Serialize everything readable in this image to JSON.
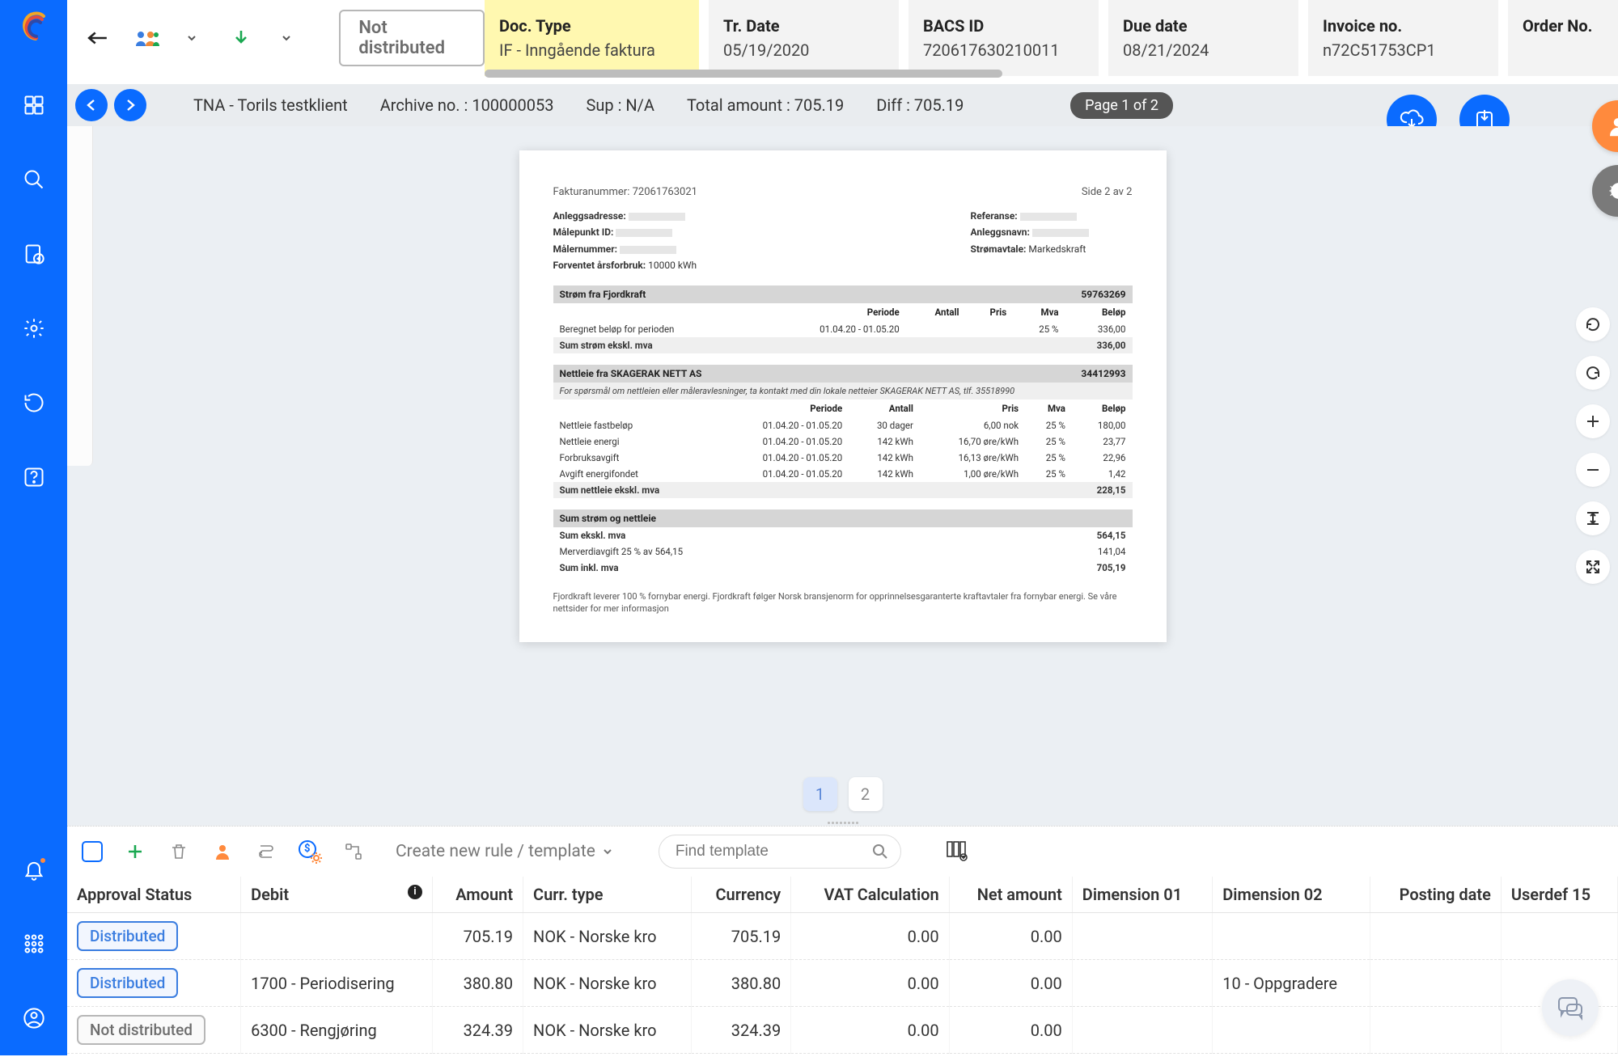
{
  "sidebar": {
    "items": [
      "dashboard",
      "search",
      "documents",
      "settings",
      "refresh",
      "help"
    ],
    "bottom": [
      "bell",
      "apps",
      "user"
    ]
  },
  "topstrip": {
    "status_chip": "Not distributed",
    "fields": [
      {
        "label": "Doc. Type",
        "value": "IF - Inngående faktura"
      },
      {
        "label": "Tr. Date",
        "value": "05/19/2020"
      },
      {
        "label": "BACS ID",
        "value": "720617630210011"
      },
      {
        "label": "Due date",
        "value": "08/21/2024"
      },
      {
        "label": "Invoice no.",
        "value": "n72C51753CP1"
      },
      {
        "label": "Order No.",
        "value": ""
      }
    ]
  },
  "metabar": {
    "client": "TNA - Torils testklient",
    "archive": "Archive no. : 100000053",
    "sup": "Sup : N/A",
    "total": "Total amount : 705.19",
    "diff": "Diff : 705.19",
    "page_pill": "Page 1 of 2"
  },
  "document": {
    "invoice_no_label": "Fakturanummer: 72061763021",
    "page_label": "Side 2 av 2",
    "meta_left": [
      {
        "k": "Anleggsadresse:",
        "v": ""
      },
      {
        "k": "Målepunkt ID:",
        "v": ""
      },
      {
        "k": "Målernummer:",
        "v": ""
      },
      {
        "k": "Forventet årsforbruk:",
        "v": "10000 kWh"
      }
    ],
    "meta_right": [
      {
        "k": "Referanse:",
        "v": ""
      },
      {
        "k": "Anleggsnavn:",
        "v": ""
      },
      {
        "k": "Strømavtale:",
        "v": "Markedskraft"
      }
    ],
    "sec1": {
      "title": "Strøm fra Fjordkraft",
      "right": "59763269",
      "headers": [
        "",
        "Periode",
        "Antall",
        "Pris",
        "Mva",
        "Beløp"
      ],
      "rows": [
        [
          "Beregnet beløp for perioden",
          "01.04.20 - 01.05.20",
          "",
          "",
          "25 %",
          "336,00"
        ]
      ],
      "total": [
        "Sum strøm ekskl. mva",
        "",
        "",
        "",
        "",
        "336,00"
      ]
    },
    "sec2": {
      "title": "Nettleie fra SKAGERAK NETT AS",
      "right": "34412993",
      "note": "For spørsmål om nettleien eller måleravlesninger, ta kontakt med din lokale netteier SKAGERAK NETT AS, tlf. 35518990",
      "headers": [
        "",
        "Periode",
        "Antall",
        "Pris",
        "Mva",
        "Beløp"
      ],
      "rows": [
        [
          "Nettleie fastbeløp",
          "01.04.20 - 01.05.20",
          "30 dager",
          "6,00 nok",
          "25 %",
          "180,00"
        ],
        [
          "Nettleie energi",
          "01.04.20 - 01.05.20",
          "142 kWh",
          "16,70 øre/kWh",
          "25 %",
          "23,77"
        ],
        [
          "Forbruksavgift",
          "01.04.20 - 01.05.20",
          "142 kWh",
          "16,13 øre/kWh",
          "25 %",
          "22,96"
        ],
        [
          "Avgift energifondet",
          "01.04.20 - 01.05.20",
          "142 kWh",
          "1,00 øre/kWh",
          "25 %",
          "1,42"
        ]
      ],
      "total": [
        "Sum nettleie ekskl. mva",
        "",
        "",
        "",
        "",
        "228,15"
      ]
    },
    "sec3": {
      "title": "Sum strøm og nettleie",
      "rows": [
        [
          "Sum ekskl. mva",
          "564,15"
        ],
        [
          "Merverdiavgift 25 % av 564,15",
          "141,04"
        ],
        [
          "Sum inkl. mva",
          "705,19"
        ]
      ]
    },
    "footer": "Fjordkraft leverer 100 % fornybar energi. Fjordkraft følger Norsk bransjenorm for opprinnelsesgaranterte kraftavtaler fra fornybar energi. Se våre nettsider for mer informasjon"
  },
  "pages": {
    "current": "1",
    "other": "2"
  },
  "grid_toolbar": {
    "rule_link": "Create new rule / template",
    "find_placeholder": "Find template"
  },
  "grid": {
    "columns": [
      "Approval Status",
      "Debit",
      "Amount",
      "Curr. type",
      "Currency",
      "VAT Calculation",
      "Net amount",
      "Dimension 01",
      "Dimension 02",
      "Posting date",
      "Userdef 15"
    ],
    "rows": [
      {
        "status": "Distributed",
        "status_kind": "dist",
        "debit": "",
        "amount": "705.19",
        "curr_type": "NOK - Norske kro",
        "currency": "705.19",
        "vat": "0.00",
        "net": "0.00",
        "dim1": "",
        "dim2": "",
        "posting": "",
        "u15": ""
      },
      {
        "status": "Distributed",
        "status_kind": "dist",
        "debit": "1700 - Periodisering",
        "amount": "380.80",
        "curr_type": "NOK - Norske kro",
        "currency": "380.80",
        "vat": "0.00",
        "net": "0.00",
        "dim1": "",
        "dim2": "10 - Oppgradere",
        "posting": "",
        "u15": ""
      },
      {
        "status": "Not distributed",
        "status_kind": "notdist",
        "debit": "6300 - Rengjøring",
        "amount": "324.39",
        "curr_type": "NOK - Norske kro",
        "currency": "324.39",
        "vat": "0.00",
        "net": "0.00",
        "dim1": "",
        "dim2": "",
        "posting": "",
        "u15": ""
      }
    ]
  }
}
